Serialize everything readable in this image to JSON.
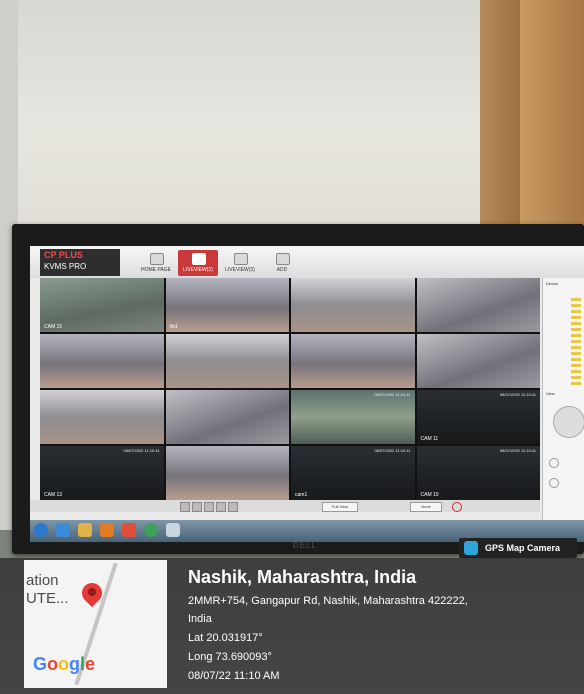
{
  "screen": {
    "logo_brand": "CP PLUS",
    "logo_product": "KVMS PRO",
    "tabs": [
      {
        "label": "HOME PAGE"
      },
      {
        "label": "LIVEVIEW(2)"
      },
      {
        "label": "LIVEVIEW(3)"
      },
      {
        "label": "ADD"
      }
    ],
    "device_label": "Device",
    "view_label": "View",
    "camera_labels": [
      "CAM 15",
      "hb1",
      "",
      "",
      "",
      "",
      "",
      "",
      "",
      "",
      "",
      "CAM 11",
      "CAM 13",
      "",
      "cam1",
      "CAM 10"
    ],
    "timestamp": "08/07/2022 11:10:11",
    "layout_select": "Full View",
    "stream_select": "None"
  },
  "monitor": {
    "brand": "DELL"
  },
  "gps_overlay": {
    "app_label": "GPS Map Camera",
    "map_text_1": "ation",
    "map_text_2": "UTE...",
    "google_g": "G",
    "google_o1": "o",
    "google_o2": "o",
    "google_g2": "g",
    "google_l": "l",
    "google_e": "e",
    "city": "Nashik, Maharashtra, India",
    "address_line": "2MMR+754, Gangapur Rd, Nashik, Maharashtra 422222,",
    "country": "India",
    "lat": "Lat 20.031917°",
    "long": "Long 73.690093°",
    "datetime": "08/07/22 11:10 AM"
  },
  "colors": {
    "accent_red": "#c93939",
    "overlay_bg": "#252525",
    "pin_red": "#e53935",
    "app_icon": "#2ea6d9"
  }
}
